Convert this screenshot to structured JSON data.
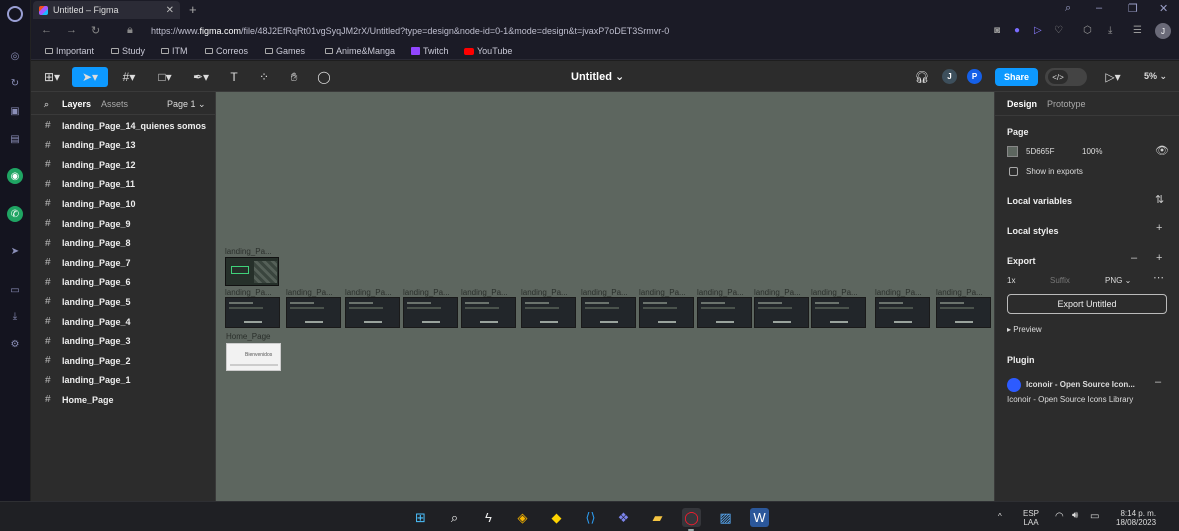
{
  "browser": {
    "tab_title": "Untitled – Figma",
    "url_prefix": "https://www.",
    "url_domain": "figma.com",
    "url_rest": "/file/48J2EfRqRt01vgSyqJM2rX/Untitled?type=design&node-id=0-1&mode=design&t=jvaxP7oDET3Srmvr-0",
    "profile_initial": "J",
    "bookmarks": [
      {
        "label": "Important",
        "icon": "folder-icon"
      },
      {
        "label": "Study",
        "icon": "folder-icon"
      },
      {
        "label": "ITM",
        "icon": "folder-icon"
      },
      {
        "label": "Correos",
        "icon": "folder-icon"
      },
      {
        "label": "Games",
        "icon": "folder-icon"
      },
      {
        "label": "Anime&Manga",
        "icon": "folder-icon"
      },
      {
        "label": "Twitch",
        "icon": "twitch-icon"
      },
      {
        "label": "YouTube",
        "icon": "youtube-icon"
      }
    ]
  },
  "toolbar": {
    "doc_title": "Untitled",
    "share_label": "Share",
    "avatar_j": "J",
    "avatar_p": "P",
    "zoom": "5%",
    "colors": {
      "accent": "#0d99ff",
      "avatar_j": "#3d4f5c",
      "avatar_p": "#1560e8"
    }
  },
  "layers_panel": {
    "tab_layers": "Layers",
    "tab_assets": "Assets",
    "page_selector": "Page 1",
    "layers": [
      "landing_Page_14_quienes somos",
      "landing_Page_13",
      "landing_Page_12",
      "landing_Page_11",
      "landing_Page_10",
      "landing_Page_9",
      "landing_Page_8",
      "landing_Page_7",
      "landing_Page_6",
      "landing_Page_5",
      "landing_Page_4",
      "landing_Page_3",
      "landing_Page_2",
      "landing_Page_1",
      "Home_Page"
    ]
  },
  "canvas": {
    "background": "#5d665f",
    "top_frame_label": "landing_Pa...",
    "row_frame_label": "landing_Pa...",
    "home_frame_label": "Home_Page",
    "home_thumb_text": "Bienvenidos"
  },
  "design_panel": {
    "tab_design": "Design",
    "tab_prototype": "Prototype",
    "page_section": "Page",
    "page_color_hex": "5D665F",
    "page_opacity": "100%",
    "show_in_exports": "Show in exports",
    "local_variables": "Local variables",
    "local_styles": "Local styles",
    "export_section": "Export",
    "export_scale": "1x",
    "export_suffix_placeholder": "Suffix",
    "export_format": "PNG",
    "export_button": "Export Untitled",
    "preview_label": "Preview",
    "plugin_section": "Plugin",
    "plugin_name": "Iconoir - Open Source Icon...",
    "plugin_desc": "Iconoir - Open Source Icons Library"
  },
  "taskbar": {
    "language": "ESP",
    "layout": "LAA",
    "time": "8:14 p. m.",
    "date": "18/08/2023"
  }
}
